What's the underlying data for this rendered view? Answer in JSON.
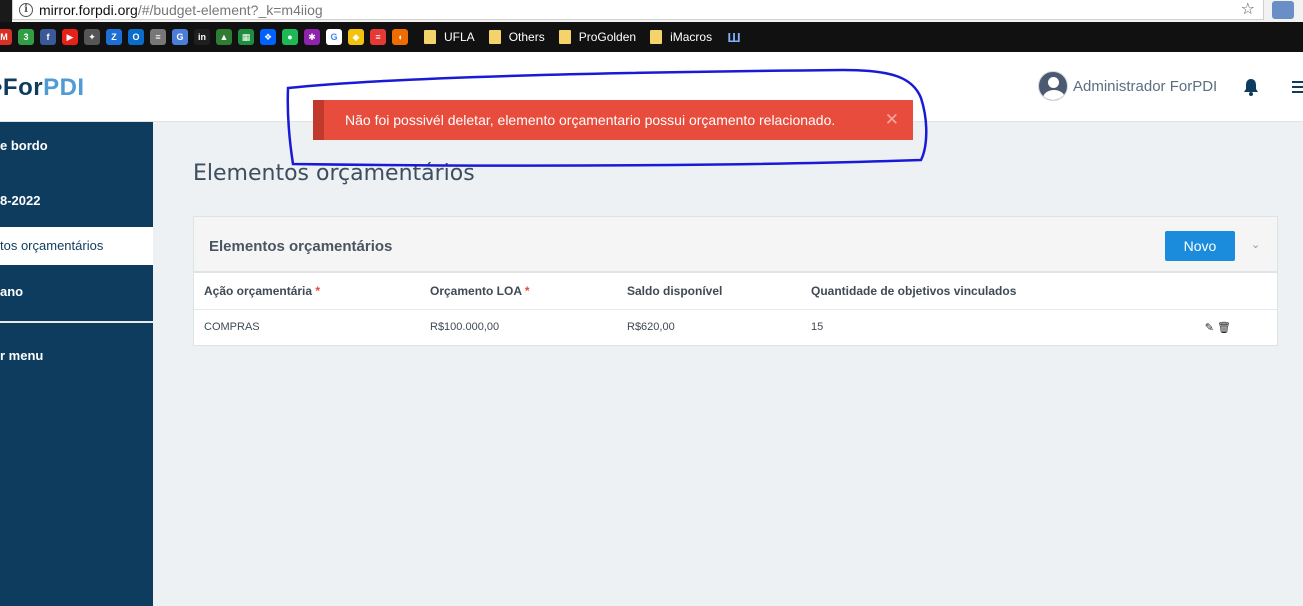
{
  "browser": {
    "url_domain": "mirror.forpdi.org",
    "url_path": "/#/budget-element?_k=m4iiog",
    "bookmarks": [
      {
        "icon": "gmail-icon",
        "color": "#d93025",
        "glyph": "M"
      },
      {
        "icon": "badge-3-icon",
        "color": "#2f9e44",
        "glyph": "3"
      },
      {
        "icon": "facebook-icon",
        "color": "#3b5998",
        "glyph": "f"
      },
      {
        "icon": "youtube-icon",
        "color": "#e62117",
        "glyph": "▶"
      },
      {
        "icon": "fan-icon",
        "color": "#555555",
        "glyph": "✦"
      },
      {
        "icon": "z-icon",
        "color": "#1d6fd6",
        "glyph": "Z"
      },
      {
        "icon": "outlook-icon",
        "color": "#0b6cc9",
        "glyph": "O"
      },
      {
        "icon": "doc-icon",
        "color": "#777777",
        "glyph": "≡"
      },
      {
        "icon": "translate-icon",
        "color": "#4a7ed9",
        "glyph": "G"
      },
      {
        "icon": "in-icon",
        "color": "#1f1f1f",
        "glyph": "in"
      },
      {
        "icon": "drive-icon",
        "color": "#2e7d32",
        "glyph": "▲"
      },
      {
        "icon": "sheets-icon",
        "color": "#1e8e3e",
        "glyph": "▦"
      },
      {
        "icon": "dropbox-icon",
        "color": "#0061fe",
        "glyph": "❖"
      },
      {
        "icon": "spotify-icon",
        "color": "#1db954",
        "glyph": "●"
      },
      {
        "icon": "figure-icon",
        "color": "#8e24aa",
        "glyph": "✱"
      },
      {
        "icon": "google-icon",
        "color": "#ffffff",
        "glyph": "G"
      },
      {
        "icon": "bank-icon",
        "color": "#f4c20d",
        "glyph": "◆"
      },
      {
        "icon": "red-flag-icon",
        "color": "#e53935",
        "glyph": "≡"
      },
      {
        "icon": "shield-icon",
        "color": "#ef6c00",
        "glyph": "◖"
      }
    ],
    "folders": [
      {
        "label": "UFLA"
      },
      {
        "label": "Others"
      },
      {
        "label": "ProGolden"
      },
      {
        "label": "iMacros"
      }
    ],
    "last_icon": "imacros-icon"
  },
  "header": {
    "logo_prefix": "•For",
    "logo_suffix": "PDI",
    "user_name": "Administrador ForPDI"
  },
  "sidebar": {
    "items": [
      {
        "label": "e bordo"
      },
      {
        "label": "8-2022"
      },
      {
        "label": "tos orçamentários"
      },
      {
        "label": "ano"
      },
      {
        "label": "r menu"
      }
    ]
  },
  "alert": {
    "message": "Não foi possivél deletar, elemento orçamentario possui orçamento relacionado.",
    "close": "✕"
  },
  "main": {
    "page_title": "Elementos orçamentários",
    "panel_title": "Elementos orçamentários",
    "new_button": "Novo",
    "table": {
      "headers": [
        {
          "label": "Ação orçamentária",
          "required": "*"
        },
        {
          "label": "Orçamento LOA",
          "required": "*"
        },
        {
          "label": "Saldo disponível",
          "required": ""
        },
        {
          "label": "Quantidade de objetivos vinculados",
          "required": ""
        }
      ],
      "rows": [
        {
          "acao": "COMPRAS",
          "loa": "R$100.000,00",
          "saldo": "R$620,00",
          "qtd": "15"
        }
      ]
    }
  }
}
